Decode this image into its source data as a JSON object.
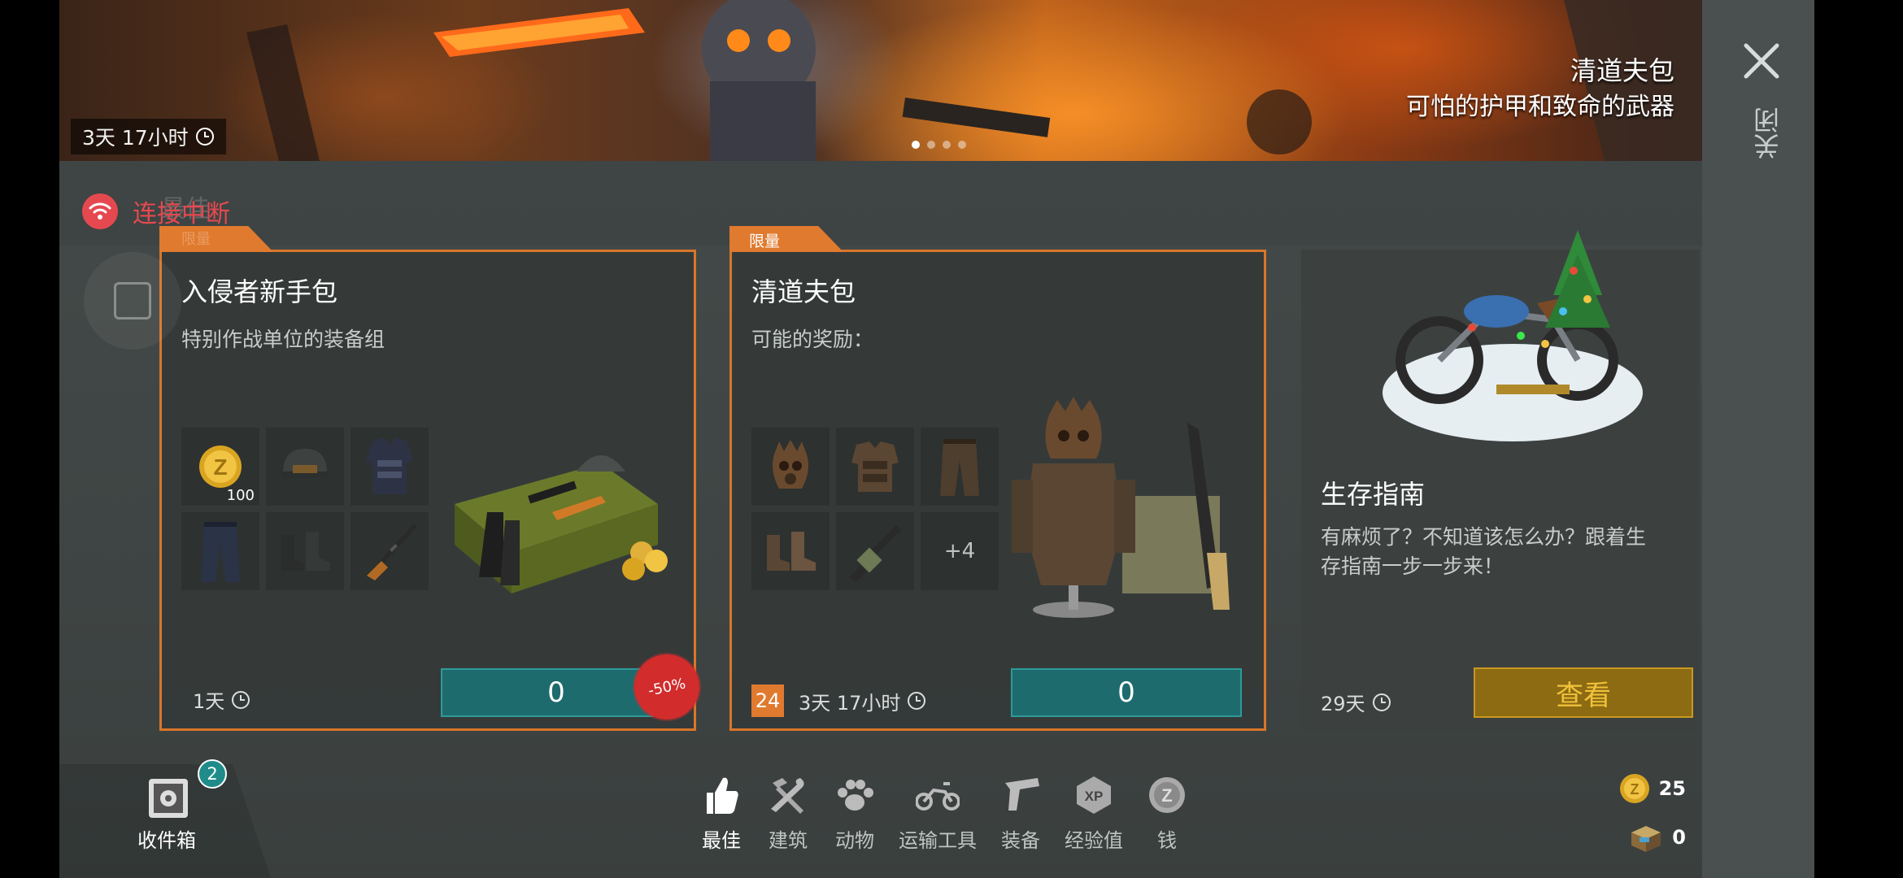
{
  "banner": {
    "timer": "3天 17小时",
    "title": "清道夫包",
    "subtitle": "可怕的护甲和致命的武器",
    "dots": 4,
    "active_dot": 0
  },
  "status": {
    "connection": "连接中断",
    "ghost_tab": "最佳",
    "ghost_tag": "限量"
  },
  "cards": [
    {
      "tag": "",
      "title": "入侵者新手包",
      "desc": "特别作战单位的装备组",
      "items": [
        {
          "icon": "gold-coin-icon",
          "count": "100"
        },
        {
          "icon": "helmet-icon",
          "count": ""
        },
        {
          "icon": "body-armor-icon",
          "count": ""
        },
        {
          "icon": "pants-icon",
          "count": ""
        },
        {
          "icon": "boots-icon",
          "count": ""
        },
        {
          "icon": "rifle-icon",
          "count": ""
        }
      ],
      "timer": "1天",
      "price": "0",
      "discount": "-50%"
    },
    {
      "tag": "限量",
      "title": "清道夫包",
      "desc": "可能的奖励：",
      "items": [
        {
          "icon": "scavenger-mask-icon",
          "count": ""
        },
        {
          "icon": "scavenger-armor-icon",
          "count": ""
        },
        {
          "icon": "scavenger-pants-icon",
          "count": ""
        },
        {
          "icon": "scavenger-boots-icon",
          "count": ""
        },
        {
          "icon": "grenade-launcher-icon",
          "count": ""
        }
      ],
      "more": "+4",
      "badge": "24",
      "timer": "3天 17小时",
      "price": "0"
    },
    {
      "title": "生存指南",
      "desc_line1": "有麻烦了？不知道该怎么办？跟着生",
      "desc_line2": "存指南一步一步来！",
      "timer": "29天",
      "button": "查看"
    }
  ],
  "inbox": {
    "label": "收件箱",
    "badge": "2"
  },
  "categories": [
    {
      "label": "最佳",
      "icon": "thumbs-up-icon",
      "active": true
    },
    {
      "label": "建筑",
      "icon": "hammer-wrench-icon",
      "active": false
    },
    {
      "label": "动物",
      "icon": "paw-icon",
      "active": false
    },
    {
      "label": "运输工具",
      "icon": "motorcycle-icon",
      "active": false
    },
    {
      "label": "装备",
      "icon": "pistol-icon",
      "active": false
    },
    {
      "label": "经验值",
      "icon": "xp-icon",
      "active": false
    },
    {
      "label": "钱",
      "icon": "coin-icon",
      "active": false
    }
  ],
  "currency": {
    "coins": "25",
    "crates": "0"
  },
  "close_label": "关闭",
  "colors": {
    "accent_orange": "#e07a2e",
    "price_teal": "#1e6b6e",
    "view_gold": "#8d6b12",
    "error_red": "#e5494f"
  }
}
